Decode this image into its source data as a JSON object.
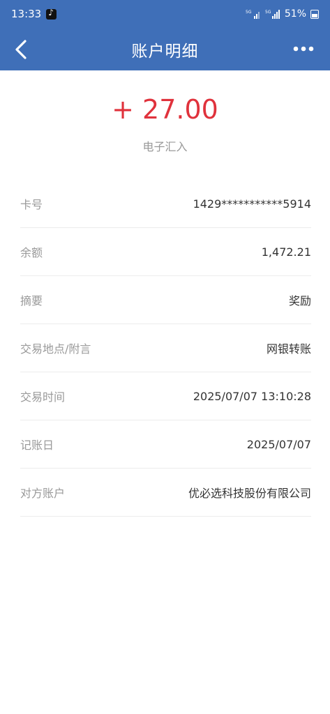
{
  "status_bar": {
    "time": "13:33",
    "battery": "51%",
    "network_1": "5G",
    "network_2": "5G"
  },
  "nav": {
    "title": "账户明细",
    "back_icon": "chevron-left-icon",
    "more_icon": "more-horizontal-icon"
  },
  "transaction": {
    "amount": "+ 27.00",
    "type": "电子汇入",
    "amount_color": "#e0323c"
  },
  "details": [
    {
      "label": "卡号",
      "value": "1429***********5914"
    },
    {
      "label": "余额",
      "value": "1,472.21"
    },
    {
      "label": "摘要",
      "value": "奖励"
    },
    {
      "label": "交易地点/附言",
      "value": "网银转账"
    },
    {
      "label": "交易时间",
      "value": "2025/07/07 13:10:28"
    },
    {
      "label": "记账日",
      "value": "2025/07/07"
    },
    {
      "label": "对方账户",
      "value": "优必选科技股份有限公司"
    }
  ],
  "colors": {
    "header_bg": "#3f6fb8",
    "label_text": "#999999",
    "value_text": "#333333"
  }
}
